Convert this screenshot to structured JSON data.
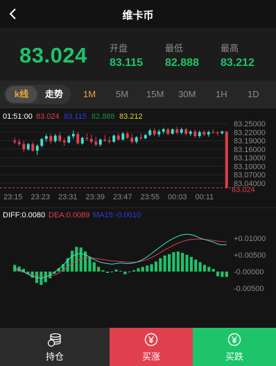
{
  "header": {
    "title": "维卡币"
  },
  "quote": {
    "price": "83.024",
    "open_label": "开盘",
    "open_value": "83.115",
    "low_label": "最低",
    "low_value": "82.888",
    "high_label": "最高",
    "high_value": "83.212"
  },
  "periods": {
    "kline": "k线",
    "trend": "走势",
    "tabs": [
      "1M",
      "5M",
      "15M",
      "30M",
      "1H",
      "1D"
    ],
    "active": "1M"
  },
  "chart_data": [
    {
      "type": "candlestick",
      "legend": {
        "time": "01:51:00",
        "v1": "83.024",
        "v2": "83.115",
        "v3": "82.888",
        "v4": "83.212"
      },
      "y_ticks": [
        "83.25000",
        "83.22000",
        "83.19000",
        "83.16000",
        "83.13000",
        "83.10000",
        "83.07000",
        "83.04000"
      ],
      "ylim": [
        83.04,
        83.25
      ],
      "x_ticks": [
        "23:15",
        "23:23",
        "23:31",
        "23:39",
        "23:47",
        "23:55",
        "00:03",
        "00:11"
      ],
      "last_price_label": "83.024",
      "candles": [
        [
          83.19,
          83.2,
          83.178,
          83.185
        ],
        [
          83.185,
          83.196,
          83.172,
          83.178
        ],
        [
          83.178,
          83.19,
          83.15,
          83.16
        ],
        [
          83.16,
          83.182,
          83.155,
          83.178
        ],
        [
          83.178,
          83.186,
          83.15,
          83.155
        ],
        [
          83.155,
          83.178,
          83.14,
          83.172
        ],
        [
          83.172,
          83.2,
          83.166,
          83.196
        ],
        [
          83.196,
          83.214,
          83.186,
          83.206
        ],
        [
          83.206,
          83.215,
          83.18,
          83.188
        ],
        [
          83.188,
          83.214,
          83.182,
          83.208
        ],
        [
          83.208,
          83.22,
          83.184,
          83.19
        ],
        [
          83.19,
          83.2,
          83.172,
          83.184
        ],
        [
          83.184,
          83.21,
          83.18,
          83.205
        ],
        [
          83.205,
          83.226,
          83.196,
          83.214
        ],
        [
          83.214,
          83.22,
          83.176,
          83.18
        ],
        [
          83.18,
          83.204,
          83.176,
          83.2
        ],
        [
          83.2,
          83.216,
          83.19,
          83.196
        ],
        [
          83.196,
          83.212,
          83.18,
          83.186
        ],
        [
          83.186,
          83.204,
          83.17,
          83.176
        ],
        [
          83.176,
          83.198,
          83.17,
          83.194
        ],
        [
          83.194,
          83.21,
          83.186,
          83.19
        ],
        [
          83.19,
          83.204,
          83.18,
          83.186
        ],
        [
          83.186,
          83.212,
          83.182,
          83.208
        ],
        [
          83.208,
          83.216,
          83.19,
          83.194
        ],
        [
          83.194,
          83.22,
          83.19,
          83.215
        ],
        [
          83.215,
          83.222,
          83.196,
          83.2
        ],
        [
          83.2,
          83.214,
          83.18,
          83.186
        ],
        [
          83.186,
          83.206,
          83.18,
          83.202
        ],
        [
          83.202,
          83.216,
          83.192,
          83.198
        ],
        [
          83.198,
          83.214,
          83.196,
          83.21
        ],
        [
          83.21,
          83.232,
          83.206,
          83.226
        ],
        [
          83.226,
          83.234,
          83.206,
          83.212
        ],
        [
          83.212,
          83.23,
          83.204,
          83.222
        ],
        [
          83.222,
          83.236,
          83.214,
          83.23
        ],
        [
          83.23,
          83.236,
          83.208,
          83.214
        ],
        [
          83.214,
          83.234,
          83.212,
          83.23
        ],
        [
          83.23,
          83.238,
          83.212,
          83.218
        ],
        [
          83.218,
          83.236,
          83.212,
          83.23
        ],
        [
          83.23,
          83.236,
          83.208,
          83.214
        ],
        [
          83.214,
          83.228,
          83.206,
          83.222
        ],
        [
          83.222,
          83.23,
          83.2,
          83.206
        ],
        [
          83.206,
          83.226,
          83.2,
          83.22
        ],
        [
          83.22,
          83.228,
          83.206,
          83.212
        ],
        [
          83.212,
          83.226,
          83.204,
          83.22
        ],
        [
          83.22,
          83.23,
          83.214,
          83.218
        ],
        [
          83.218,
          83.224,
          83.208,
          83.216
        ],
        [
          83.216,
          83.226,
          83.212,
          83.222
        ],
        [
          83.222,
          83.224,
          83.024,
          83.024
        ]
      ]
    },
    {
      "type": "macd",
      "legend": {
        "diff": "DIFF:0.0080",
        "dea": "DEA:0.0089",
        "ma": "MA15:-0.0010"
      },
      "y_ticks": [
        "+0.01000",
        "+0.00500",
        "-0.00000",
        "-0.00500"
      ],
      "ylim": [
        -0.0085,
        0.0135
      ],
      "histogram": [
        0.002,
        0.0015,
        0.0008,
        -0.0008,
        -0.0018,
        -0.0034,
        -0.004,
        -0.0032,
        -0.002,
        -0.0006,
        0.001,
        0.0022,
        0.004,
        0.0062,
        0.0074,
        0.0072,
        0.006,
        0.0044,
        0.0028,
        0.0014,
        0.0004,
        -0.0004,
        -0.0002,
        0.0006,
        0.0002,
        -0.0008,
        -0.0002,
        0.0004,
        0.001,
        0.0014,
        0.0018,
        0.0022,
        0.003,
        0.004,
        0.0048,
        0.0052,
        0.0058,
        0.006,
        0.0056,
        0.005,
        0.0044,
        0.0036,
        0.0028,
        0.002,
        0.0014,
        0.0008,
        -0.0014,
        -0.0016,
        -0.0016
      ],
      "diff_line": [
        0.001,
        0.0006,
        0.0,
        -0.0008,
        -0.0014,
        -0.0018,
        -0.002,
        -0.0016,
        -0.001,
        -0.0002,
        0.0008,
        0.002,
        0.0034,
        0.0046,
        0.0052,
        0.0054,
        0.005,
        0.0044,
        0.0036,
        0.003,
        0.0026,
        0.0024,
        0.0022,
        0.0024,
        0.0026,
        0.0024,
        0.0024,
        0.0026,
        0.003,
        0.0036,
        0.0044,
        0.0054,
        0.0064,
        0.0074,
        0.0084,
        0.0092,
        0.01,
        0.0106,
        0.011,
        0.0112,
        0.011,
        0.0106,
        0.01,
        0.0096,
        0.0092,
        0.0088,
        0.0082,
        0.008,
        0.008
      ],
      "dea_line": [
        0.0004,
        0.0002,
        -0.0002,
        -0.0006,
        -0.001,
        -0.0013,
        -0.0015,
        -0.0015,
        -0.0013,
        -0.001,
        -0.0004,
        0.0004,
        0.0014,
        0.0024,
        0.0032,
        0.0038,
        0.0041,
        0.0042,
        0.004,
        0.0038,
        0.0036,
        0.0034,
        0.0032,
        0.0031,
        0.003,
        0.0029,
        0.0028,
        0.0028,
        0.0029,
        0.0032,
        0.0036,
        0.0042,
        0.0049,
        0.0057,
        0.0065,
        0.0072,
        0.0079,
        0.0085,
        0.009,
        0.0094,
        0.0096,
        0.0097,
        0.0097,
        0.0096,
        0.0095,
        0.0093,
        0.0091,
        0.009,
        0.0089
      ]
    }
  ],
  "colors": {
    "up": "#1ec46a",
    "down": "#e0404e",
    "accent": "#e8a53a",
    "candle_up": "#3ee0d0",
    "candle_down": "#e0404e"
  },
  "actions": {
    "hold_label": "持仓",
    "buy_label": "买涨",
    "sell_label": "买跌",
    "hold_icon": "coins-stack-icon",
    "buy_icon": "yen-coin-up-icon",
    "sell_icon": "yen-coin-down-icon"
  }
}
